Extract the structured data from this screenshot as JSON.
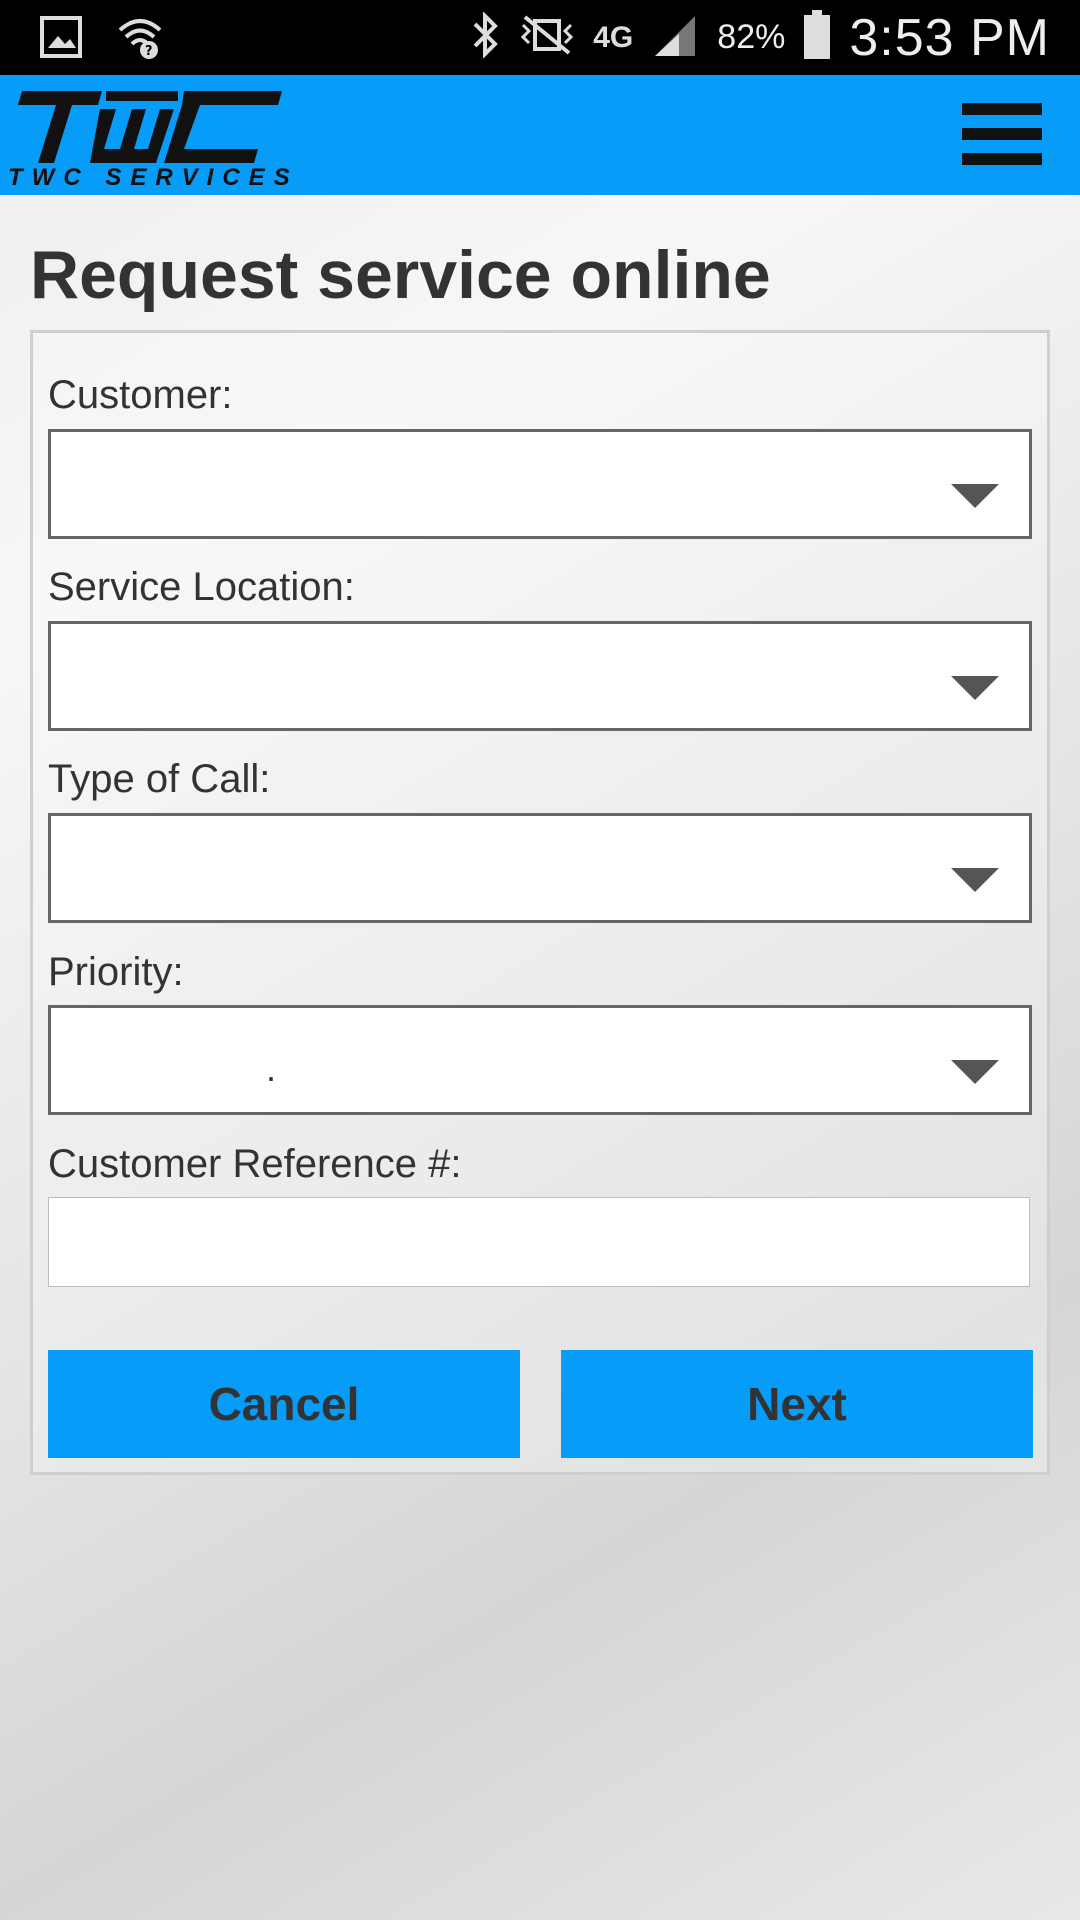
{
  "status_bar": {
    "network": "4G",
    "battery": "82%",
    "time": "3:53 PM",
    "icons": [
      "gallery-icon",
      "wifi-question-icon",
      "bluetooth-icon",
      "vibrate-mute-icon",
      "network-4g-icon",
      "signal-icon",
      "battery-icon"
    ]
  },
  "header": {
    "logo_text": "TWC",
    "logo_subtitle": "TWC SERVICES",
    "brand_color": "#069cf7",
    "menu_icon": "hamburger-menu-icon"
  },
  "page": {
    "title": "Request service online"
  },
  "form": {
    "customer": {
      "label": "Customer:",
      "value": ""
    },
    "service_location": {
      "label": "Service Location:",
      "value": ""
    },
    "type_of_call": {
      "label": "Type of Call:",
      "value": ""
    },
    "priority": {
      "label": "Priority:",
      "value": "."
    },
    "customer_reference": {
      "label": "Customer Reference #:",
      "value": ""
    },
    "cancel_label": "Cancel",
    "next_label": "Next"
  }
}
